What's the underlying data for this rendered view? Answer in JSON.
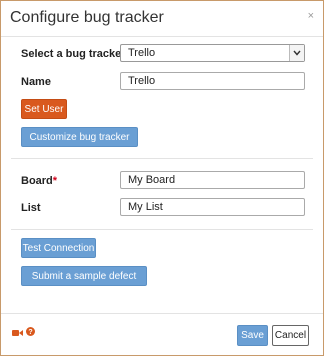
{
  "dialog": {
    "title": "Configure bug tracker",
    "close_label": "×"
  },
  "form": {
    "tracker_label": "Select a bug tracker",
    "tracker_value": "Trello",
    "name_label": "Name",
    "name_value": "Trello",
    "set_user_label": "Set User",
    "customize_label": "Customize bug tracker fields",
    "board_label": "Board",
    "board_required": "*",
    "board_value": "My Board",
    "list_label": "List",
    "list_value": "My List",
    "test_connection_label": "Test Connection",
    "submit_sample_label": "Submit a sample defect report"
  },
  "footer": {
    "video_icon": "video-camera-icon",
    "help_icon": "help-icon",
    "save_label": "Save",
    "cancel_label": "Cancel"
  },
  "colors": {
    "primary": "#6a9fd4",
    "accent": "#d9591e",
    "border": "#c89a6a"
  }
}
